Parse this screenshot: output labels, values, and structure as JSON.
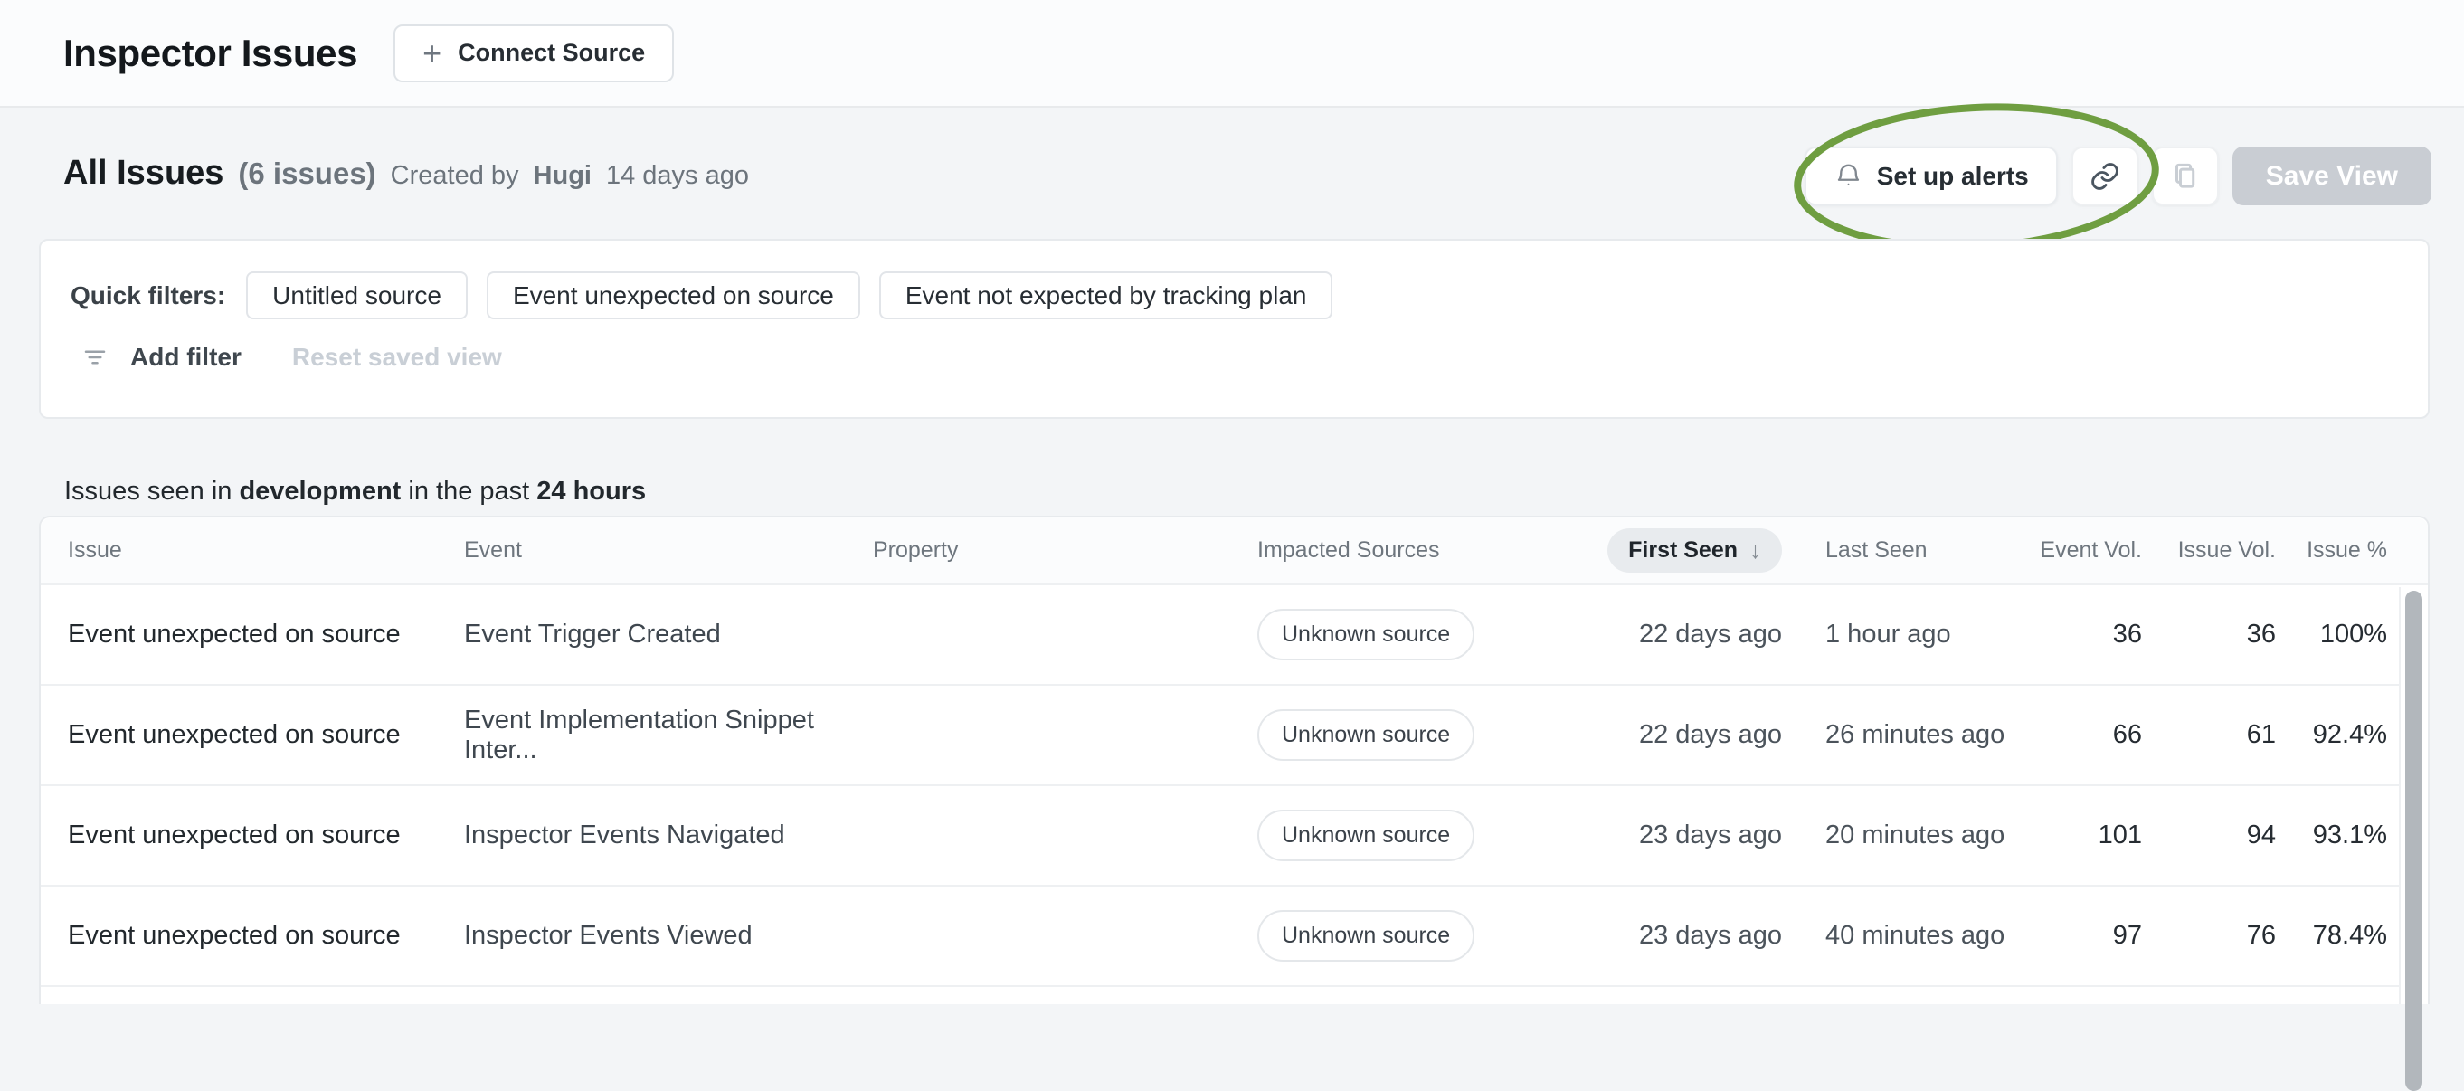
{
  "topbar": {
    "title": "Inspector Issues",
    "connect_source_label": "Connect Source",
    "plus_glyph": "+"
  },
  "view_bar": {
    "title": "All Issues",
    "count": "(6 issues)",
    "created_prefix": "Created by",
    "author": "Hugi",
    "created_ago": "14 days ago",
    "set_up_alerts_label": "Set up alerts",
    "save_view_label": "Save View"
  },
  "filters": {
    "label": "Quick filters:",
    "chips": [
      "Untitled source",
      "Event unexpected on source",
      "Event not expected by tracking plan"
    ],
    "add_filter_label": "Add filter",
    "reset_label": "Reset saved view"
  },
  "scope": {
    "prefix": "Issues seen in",
    "environment": "development",
    "middle": "in the past",
    "timeframe": "24 hours"
  },
  "table": {
    "columns": [
      "Issue",
      "Event",
      "Property",
      "Impacted Sources",
      "First Seen",
      "Last Seen",
      "Event Vol.",
      "Issue Vol.",
      "Issue %"
    ],
    "sort": {
      "column": "First Seen",
      "direction_icon": "↓"
    },
    "rows": [
      {
        "issue": "Event unexpected on source",
        "event": "Event Trigger Created",
        "property": "",
        "impacted_source": "Unknown source",
        "first_seen": "22 days ago",
        "last_seen": "1 hour ago",
        "event_vol": "36",
        "issue_vol": "36",
        "issue_pct": "100%"
      },
      {
        "issue": "Event unexpected on source",
        "event": "Event Implementation Snippet Inter...",
        "property": "",
        "impacted_source": "Unknown source",
        "first_seen": "22 days ago",
        "last_seen": "26 minutes ago",
        "event_vol": "66",
        "issue_vol": "61",
        "issue_pct": "92.4%"
      },
      {
        "issue": "Event unexpected on source",
        "event": "Inspector Events Navigated",
        "property": "",
        "impacted_source": "Unknown source",
        "first_seen": "23 days ago",
        "last_seen": "20 minutes ago",
        "event_vol": "101",
        "issue_vol": "94",
        "issue_pct": "93.1%"
      },
      {
        "issue": "Event unexpected on source",
        "event": "Inspector Events Viewed",
        "property": "",
        "impacted_source": "Unknown source",
        "first_seen": "23 days ago",
        "last_seen": "40 minutes ago",
        "event_vol": "97",
        "issue_vol": "76",
        "issue_pct": "78.4%"
      }
    ]
  },
  "colors": {
    "annotation_green": "#6f9e41",
    "disabled_button": "#c9cdd3",
    "page_background": "#f3f5f7"
  }
}
